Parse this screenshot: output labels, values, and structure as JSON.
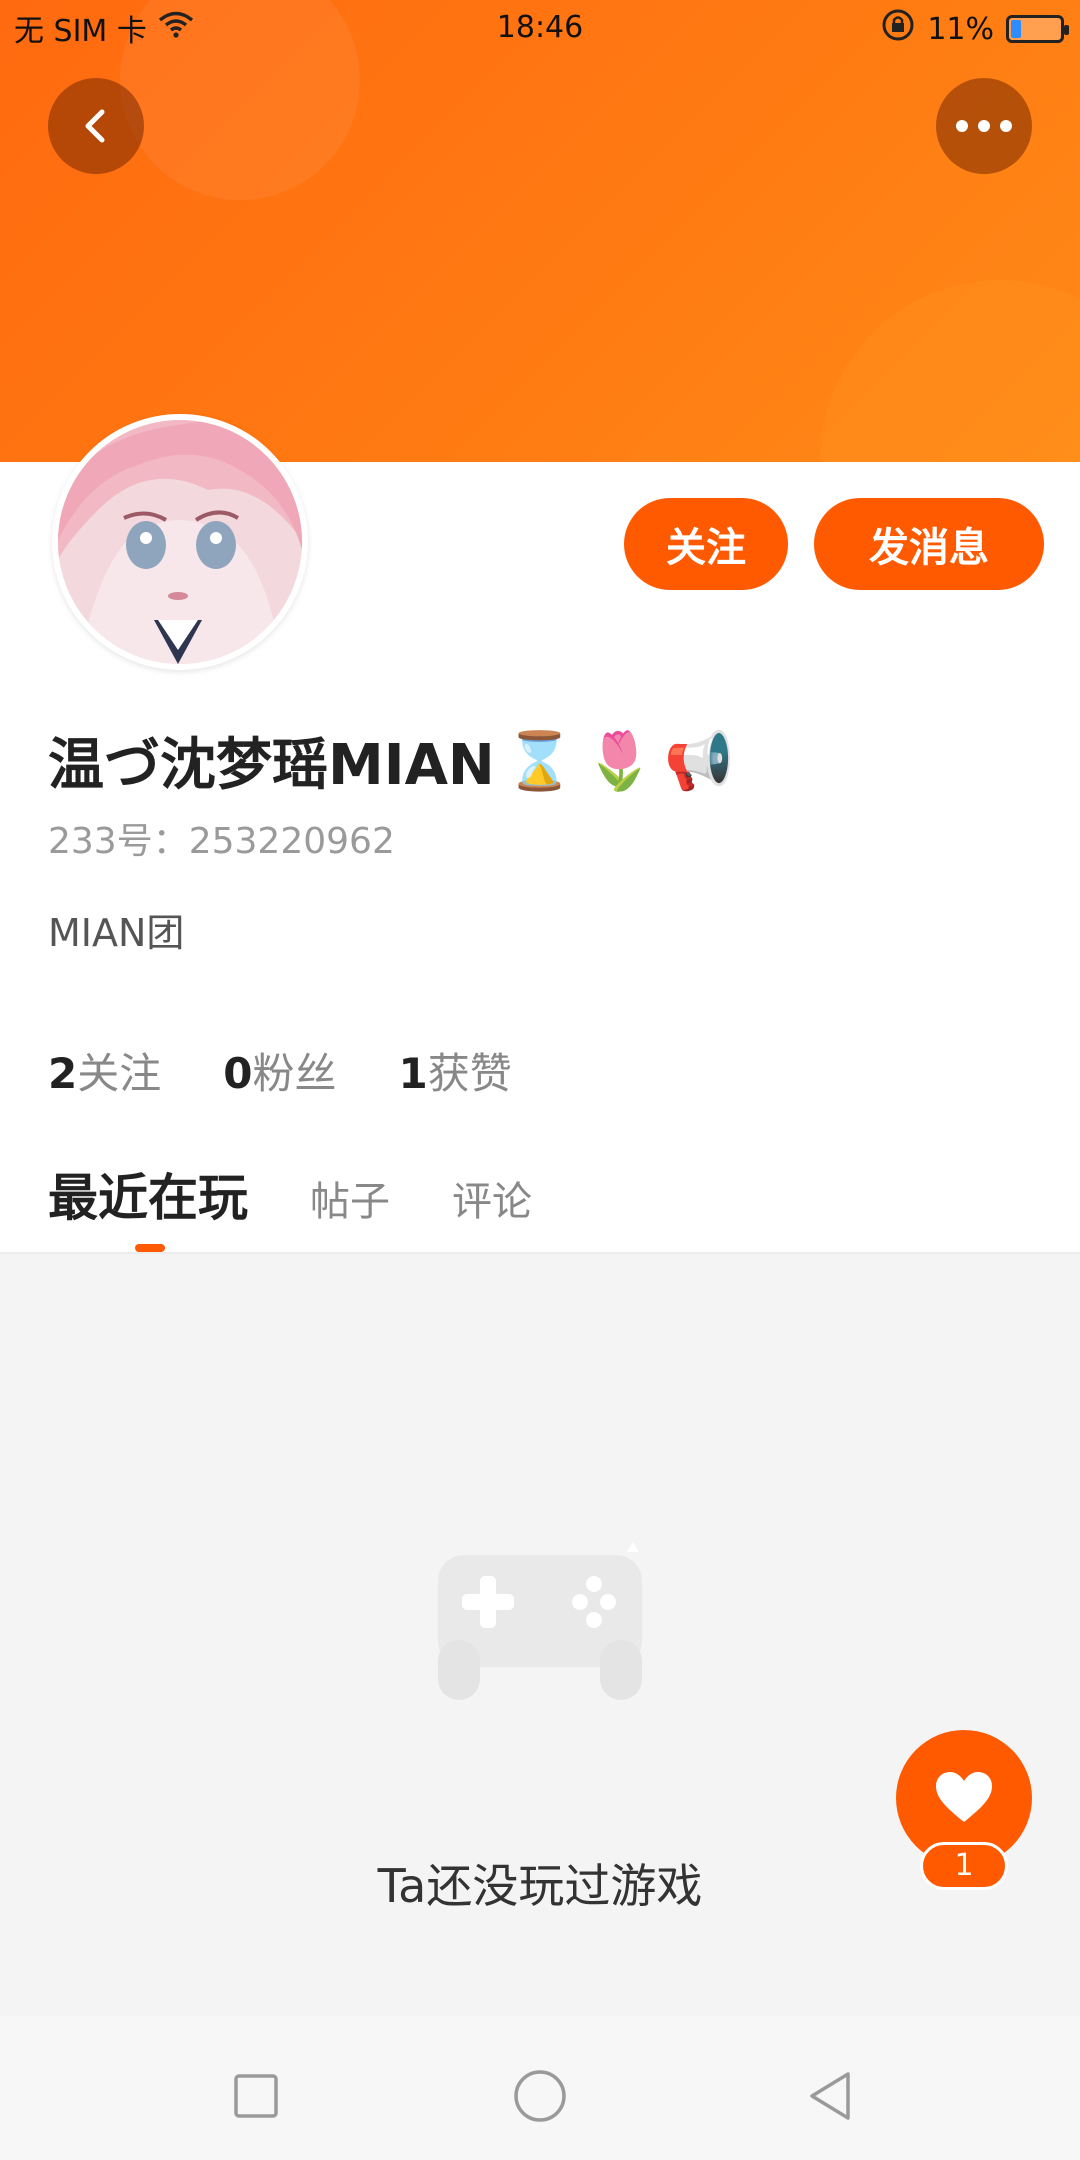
{
  "status_bar": {
    "carrier": "无 SIM 卡",
    "time": "18:46",
    "battery": "11%"
  },
  "header": {
    "back_icon": "chevron-left-icon",
    "more_icon": "more-dots-icon",
    "accent_color": "#ff6a10"
  },
  "profile": {
    "username": "温づ沈梦瑶MIAN",
    "username_emojis": [
      "⌛",
      "🌷",
      "📢"
    ],
    "uid": "233号：253220962",
    "bio": "MIAN团",
    "follow_label": "关注",
    "message_label": "发消息",
    "stats": [
      {
        "value": "2",
        "label": "关注"
      },
      {
        "value": "0",
        "label": "粉丝"
      },
      {
        "value": "1",
        "label": "获赞"
      }
    ]
  },
  "tabs": [
    {
      "label": "最近在玩",
      "active": true
    },
    {
      "label": "帖子",
      "active": false
    },
    {
      "label": "评论",
      "active": false
    }
  ],
  "content": {
    "empty_text": "Ta还没玩过游戏",
    "empty_icon": "gamepad-icon"
  },
  "fab": {
    "icon": "heart-icon",
    "count": "1"
  },
  "nav": {
    "recents_icon": "square-icon",
    "home_icon": "circle-icon",
    "back_icon": "triangle-back-icon"
  }
}
